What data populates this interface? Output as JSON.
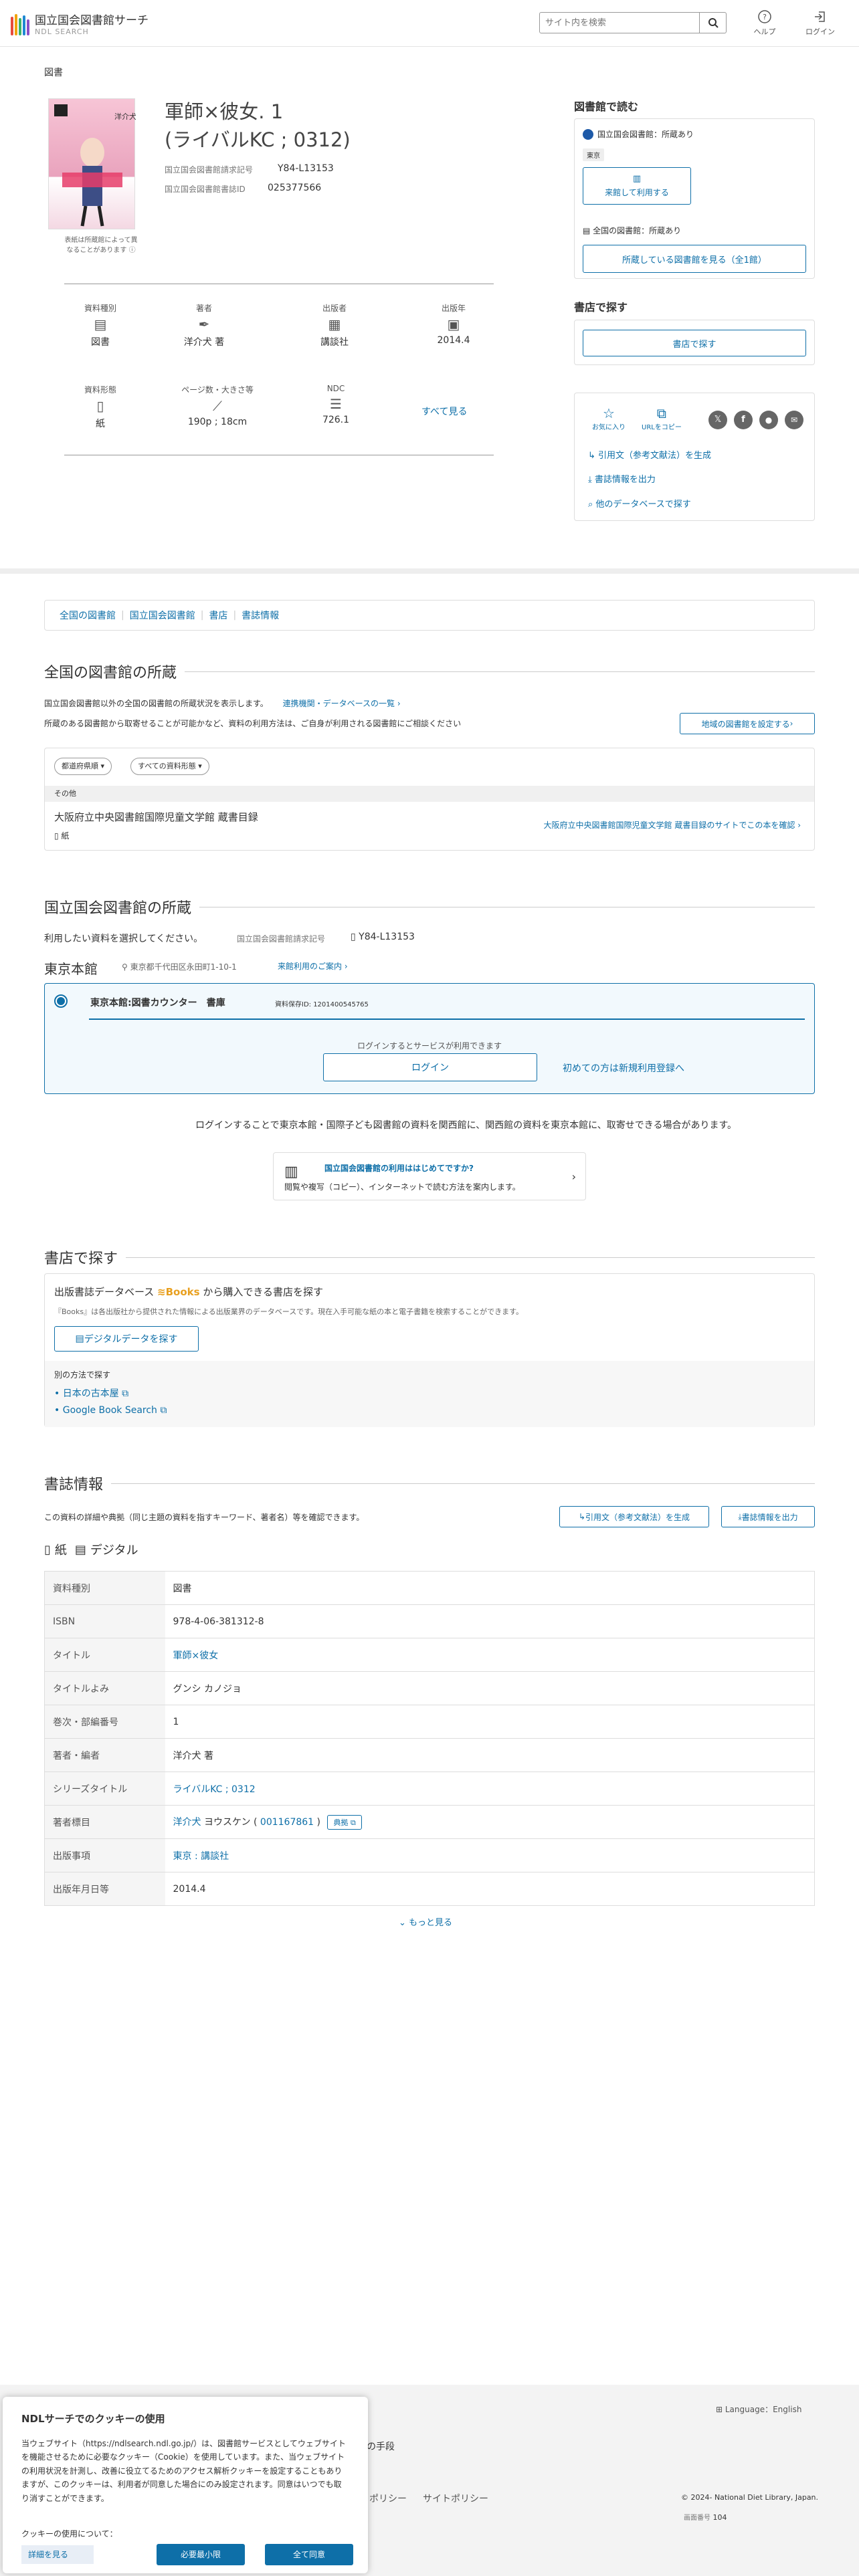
{
  "header": {
    "logo_title": "国立国会図書館サーチ",
    "logo_sub": "NDL SEARCH",
    "search_placeholder": "サイト内を検索",
    "help": "ヘルプ",
    "login": "ログイン"
  },
  "item": {
    "kind": "図書",
    "title_line1": "軍師×彼女. 1",
    "title_line2": "(ライバルKC ; 0312)",
    "call_label": "国立国会図書館請求記号",
    "call_value": "Y84-L13153",
    "id_label": "国立国会図書館書誌ID",
    "id_value": "025377566",
    "cover_note": "表紙は所蔵館によって異なることがあります"
  },
  "meta": {
    "type_label": "資料種別",
    "type_value": "図書",
    "author_label": "著者",
    "author_value": "洋介犬 著",
    "pub_label": "出版者",
    "pub_value": "講談社",
    "year_label": "出版年",
    "year_value": "2014.4",
    "form_label": "資料形態",
    "form_value": "紙",
    "page_label": "ページ数・大きさ等",
    "page_value": "190p ; 18cm",
    "ndc_label": "NDC",
    "ndc_value": "726.1",
    "show_all": "すべて見る"
  },
  "side": {
    "read_h": "図書館で読む",
    "ndl_hold": "国立国会図書館：所蔵あり",
    "tokyo_tag": "東京",
    "visit_btn": "来館して利用する",
    "all_hold": "全国の図書館：所蔵あり",
    "all_btn": "所蔵している図書館を見る（全1館）",
    "shop_h": "書店で探す",
    "shop_btn": "書店で探す",
    "fav": "お気に入り",
    "urlcopy": "URLをコピー",
    "cite": "引用文（参考文献法）を生成",
    "export": "書誌情報を出力",
    "other_db": "他のデータベースで探す"
  },
  "tabs": [
    "全国の図書館",
    "国立国会図書館",
    "書店",
    "書誌情報"
  ],
  "national": {
    "h": "全国の図書館の所蔵",
    "desc1": "国立国会図書館以外の全国の図書館の所蔵状況を表示します。",
    "desc1_link": "連携機関・データベースの一覧",
    "desc2": "所蔵のある図書館から取寄せることが可能かなど、資料の利用方法は、ご自身が利用される図書館にご相談ください",
    "region_btn": "地域の図書館を設定する",
    "pref_select": "都道府県順",
    "kind_select": "すべての資料形態",
    "group": "その他",
    "lib_name": "大阪府立中央図書館国際児童文学館 蔵書目録",
    "lib_form": "紙",
    "lib_link": "大阪府立中央図書館国際児童文学館 蔵書目録のサイトでこの本を確認"
  },
  "ndl": {
    "h": "国立国会図書館の所蔵",
    "select_text": "利用したい資料を選択してください。",
    "call_label": "国立国会図書館請求記号",
    "call_value": "Y84-L13153",
    "branch": "東京本館",
    "address": "東京都千代田区永田町1-10-1",
    "visit_guide": "来館利用のご案内",
    "counter": "東京本館:図書カウンター　書庫",
    "reg_id": "資料保存ID: 1201400545765",
    "login_note": "ログインするとサービスが利用できます",
    "login_btn": "ログイン",
    "register": "初めての方は新規利用登録へ",
    "transfer_note": "ログインすることで東京本館・国際子ども図書館の資料を関西館に、関西館の資料を東京本館に、取寄せできる場合があります。",
    "guide_title": "国立国会図書館の利用ははじめてですか?",
    "guide_desc": "閲覧や複写（コピー）、インターネットで読む方法を案内します。"
  },
  "shop": {
    "h": "書店で探す",
    "line": "出版書誌データベース",
    "books_logo": "Books",
    "line2": "から購入できる書店を探す",
    "desc": "『Books』は各出版社から提供された情報による出版業界のデータベースです。現在入手可能な紙の本と電子書籍を検索することができます。",
    "digital_btn": "デジタルデータを探す",
    "alt_h": "別の方法で探す",
    "alt1": "日本の古本屋",
    "alt2": "Google Book Search"
  },
  "biblio": {
    "h": "書誌情報",
    "desc": "この資料の詳細や典拠（同じ主題の資料を指すキーワード、著者名）等を確認できます。",
    "cite_btn": "引用文（参考文献法）を生成",
    "export_btn": "書誌情報を出力",
    "paper": "紙",
    "digital": "デジタル",
    "rows": [
      [
        "資料種別",
        "図書"
      ],
      [
        "ISBN",
        "978-4-06-381312-8"
      ],
      [
        "タイトル",
        "軍師×彼女"
      ],
      [
        "タイトルよみ",
        "グンシ カノジョ"
      ],
      [
        "巻次・部編番号",
        "1"
      ],
      [
        "著者・編者",
        "洋介犬 著"
      ],
      [
        "シリーズタイトル",
        "ライバルKC ; 0312"
      ],
      [
        "著者標目",
        "洋介犬"
      ],
      [
        "出版事項",
        "東京 : 講談社"
      ],
      [
        "出版年月日等",
        "2014.4"
      ]
    ],
    "auth_reading": "ヨウスケン",
    "auth_id": "001167861",
    "auth_btn": "典拠",
    "more": "もっと見る"
  },
  "footer": {
    "lang": "Language：English",
    "partial1": "の手段",
    "partial2": "ポリシー",
    "partial3": "サイトポリシー",
    "copy": "© 2024- National Diet Library, Japan.",
    "screen_label": "画面番号",
    "screen_no": "104"
  },
  "cookie": {
    "title": "NDLサーチでのクッキーの使用",
    "body": "当ウェブサイト（https://ndlsearch.ndl.go.jp/）は、図書館サービスとしてウェブサイトを機能させるために必要なクッキー（Cookie）を使用しています。また、当ウェブサイトの利用状況を計測し、改善に役立てるためのアクセス解析クッキーを設定することもありますが、このクッキーは、利用者が同意した場合にのみ設定されます。同意はいつでも取り消すことができます。",
    "q": "クッキーの使用について：",
    "detail": "詳細を見る",
    "min_btn": "必要最小限",
    "all_btn": "全て同意"
  },
  "colors": {
    "accent": "#0e6fa8",
    "books_orange": "#e8a020"
  }
}
